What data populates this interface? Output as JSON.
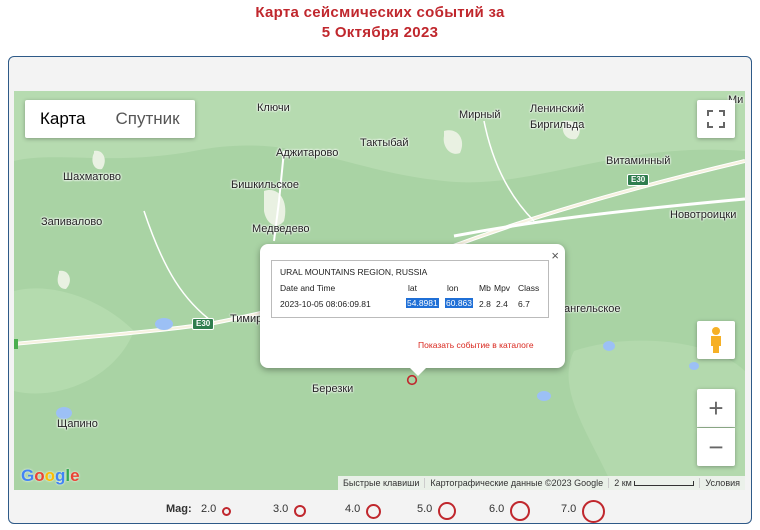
{
  "title": {
    "line1": "Карта сейсмических событий за",
    "line2": "5 Октября 2023"
  },
  "map_type": {
    "map_label": "Карта",
    "satellite_label": "Спутник",
    "active": "map"
  },
  "places": {
    "klyuchi": "Ключи",
    "mirny": "Мирный",
    "leninsky": "Ленинский",
    "birgilda": "Биргильда",
    "tau": "Ми",
    "adzhitarovo": "Аджитарово",
    "taktybay": "Тактыбай",
    "shakhmatovo": "Шахматово",
    "bishkilskoe": "Бишкильское",
    "vitaminny": "Витаминный",
    "zapivalovo": "Запивалово",
    "novotroitsk": "Новотроицки",
    "medvedevo": "Медведево",
    "timir": "Тимир",
    "angelskoe": "ангельское",
    "berezki": "Березки",
    "shchapino": "Щапино"
  },
  "roads": {
    "e30_a": "E30",
    "e30_b": "E30"
  },
  "popup": {
    "region": "URAL MOUNTAINS REGION, RUSSIA",
    "headers": {
      "datetime": "Date and Time",
      "lat": "lat",
      "lon": "lon",
      "mb": "Mb",
      "mpv": "Mpv",
      "class": "Class"
    },
    "event": {
      "datetime": "2023-10-05 08:06:09.81",
      "lat": "54.8981",
      "lon": "60.863",
      "mb": "2.8",
      "mpv": "2.4",
      "class": "6.7"
    },
    "link": "Показать событие в каталоге",
    "close": "×"
  },
  "controls": {
    "zoom_in": "+",
    "zoom_out": "−"
  },
  "logo": "Google",
  "attribution": {
    "shortcuts": "Быстрые клавиши",
    "data": "Картографические данные ©2023 Google",
    "scale": "2 км",
    "terms": "Условия"
  },
  "legend": {
    "label": "Mag:",
    "items": [
      {
        "value": "2.0",
        "size": 2.0
      },
      {
        "value": "3.0",
        "size": 3.0
      },
      {
        "value": "4.0",
        "size": 4.0
      },
      {
        "value": "5.0",
        "size": 5.0
      },
      {
        "value": "6.0",
        "size": 6.0
      },
      {
        "value": "7.0",
        "size": 7.0
      }
    ],
    "color": "#c0272d"
  },
  "colors": {
    "title": "#c0272d",
    "marker": "#c0272d",
    "map_green": "#a9d3a4",
    "link": "#d9281f"
  }
}
